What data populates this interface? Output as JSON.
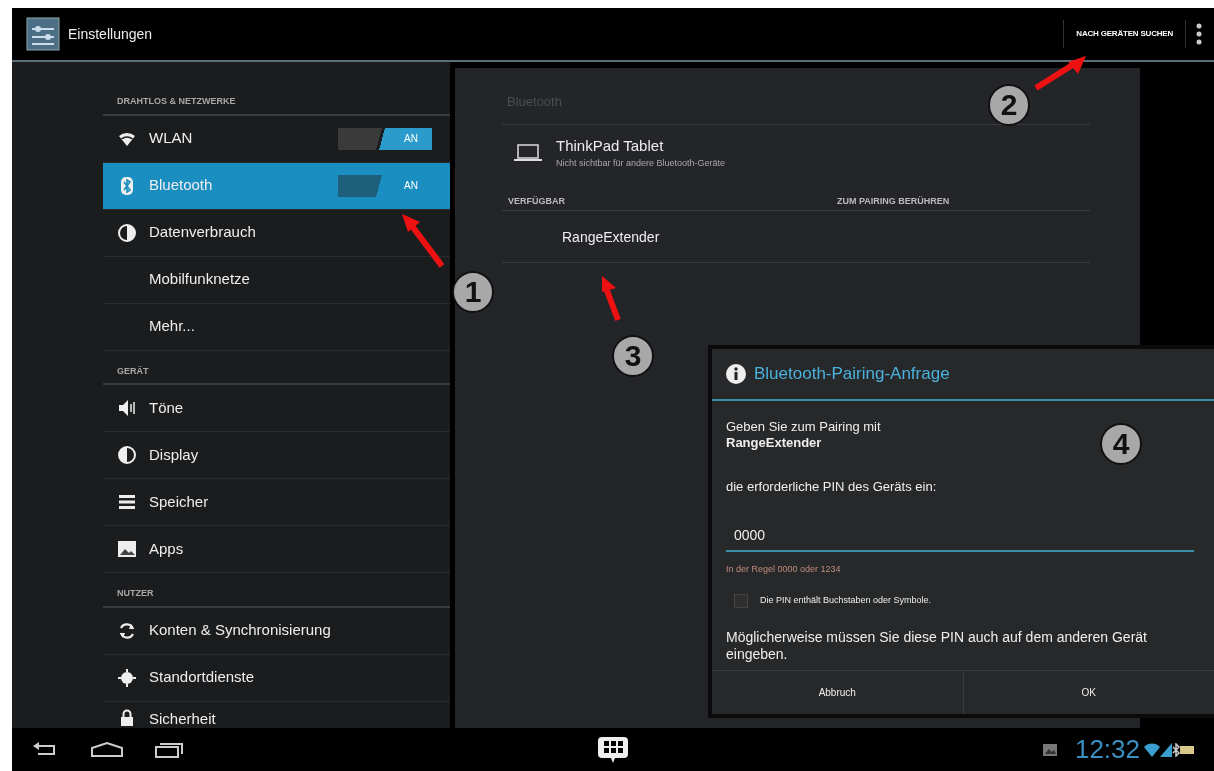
{
  "action_bar": {
    "title": "Einstellungen",
    "action": "NACH GERÄTEN SUCHEN"
  },
  "sidebar": {
    "sections": [
      {
        "header": "DRAHTLOS & NETZWERKE",
        "items": [
          {
            "label": "WLAN",
            "kind": "toggle",
            "on": true,
            "toggle_label": "AN",
            "selected": false
          },
          {
            "label": "Bluetooth",
            "kind": "toggle",
            "on": true,
            "toggle_label": "AN",
            "selected": true
          },
          {
            "label": "Datenverbrauch",
            "kind": "plain",
            "selected": false
          },
          {
            "label": "Mobilfunknetze",
            "kind": "plain",
            "selected": false
          },
          {
            "label": "Mehr...",
            "kind": "plain",
            "selected": false
          }
        ]
      },
      {
        "header": "GERÄT",
        "items": [
          {
            "label": "Töne",
            "kind": "plain",
            "selected": false
          },
          {
            "label": "Display",
            "kind": "plain",
            "selected": false
          },
          {
            "label": "Speicher",
            "kind": "plain",
            "selected": false
          },
          {
            "label": "Apps",
            "kind": "plain",
            "selected": false
          }
        ]
      },
      {
        "header": "NUTZER",
        "items": [
          {
            "label": "Konten & Synchronisierung",
            "kind": "plain",
            "selected": false
          },
          {
            "label": "Standortdienste",
            "kind": "plain",
            "selected": false
          },
          {
            "label": "Sicherheit",
            "kind": "plain",
            "selected": false
          }
        ]
      }
    ]
  },
  "detail": {
    "title": "Bluetooth",
    "this_device": {
      "name": "ThinkPad Tablet",
      "subtitle": "Nicht sichtbar für andere Bluetooth-Geräte"
    },
    "available_header": "VERFÜGBAR",
    "hint_header": "ZUM PAIRING BERÜHREN",
    "devices": [
      {
        "name": "RangeExtender"
      }
    ]
  },
  "dialog": {
    "title": "Bluetooth-Pairing-Anfrage",
    "message": "Geben Sie zum Pairing mit\n**RangeExtender**",
    "prompt": "die erforderliche PIN des Geräts ein:",
    "pin": {
      "value": "0000"
    },
    "hint": "In der Regel 0000 oder 1234",
    "checkbox": {
      "label": "Die PIN enthält Buchstaben oder Symbole.",
      "checked": false
    },
    "note": "Möglicherweise müssen Sie diese PIN auch auf dem anderen Gerät eingeben.",
    "buttons": [
      "Abbruch",
      "OK"
    ]
  },
  "status_bar": {
    "time": "12:32"
  },
  "annotations": [
    {
      "number": "1"
    },
    {
      "number": "2"
    },
    {
      "number": "3"
    },
    {
      "number": "4"
    }
  ]
}
